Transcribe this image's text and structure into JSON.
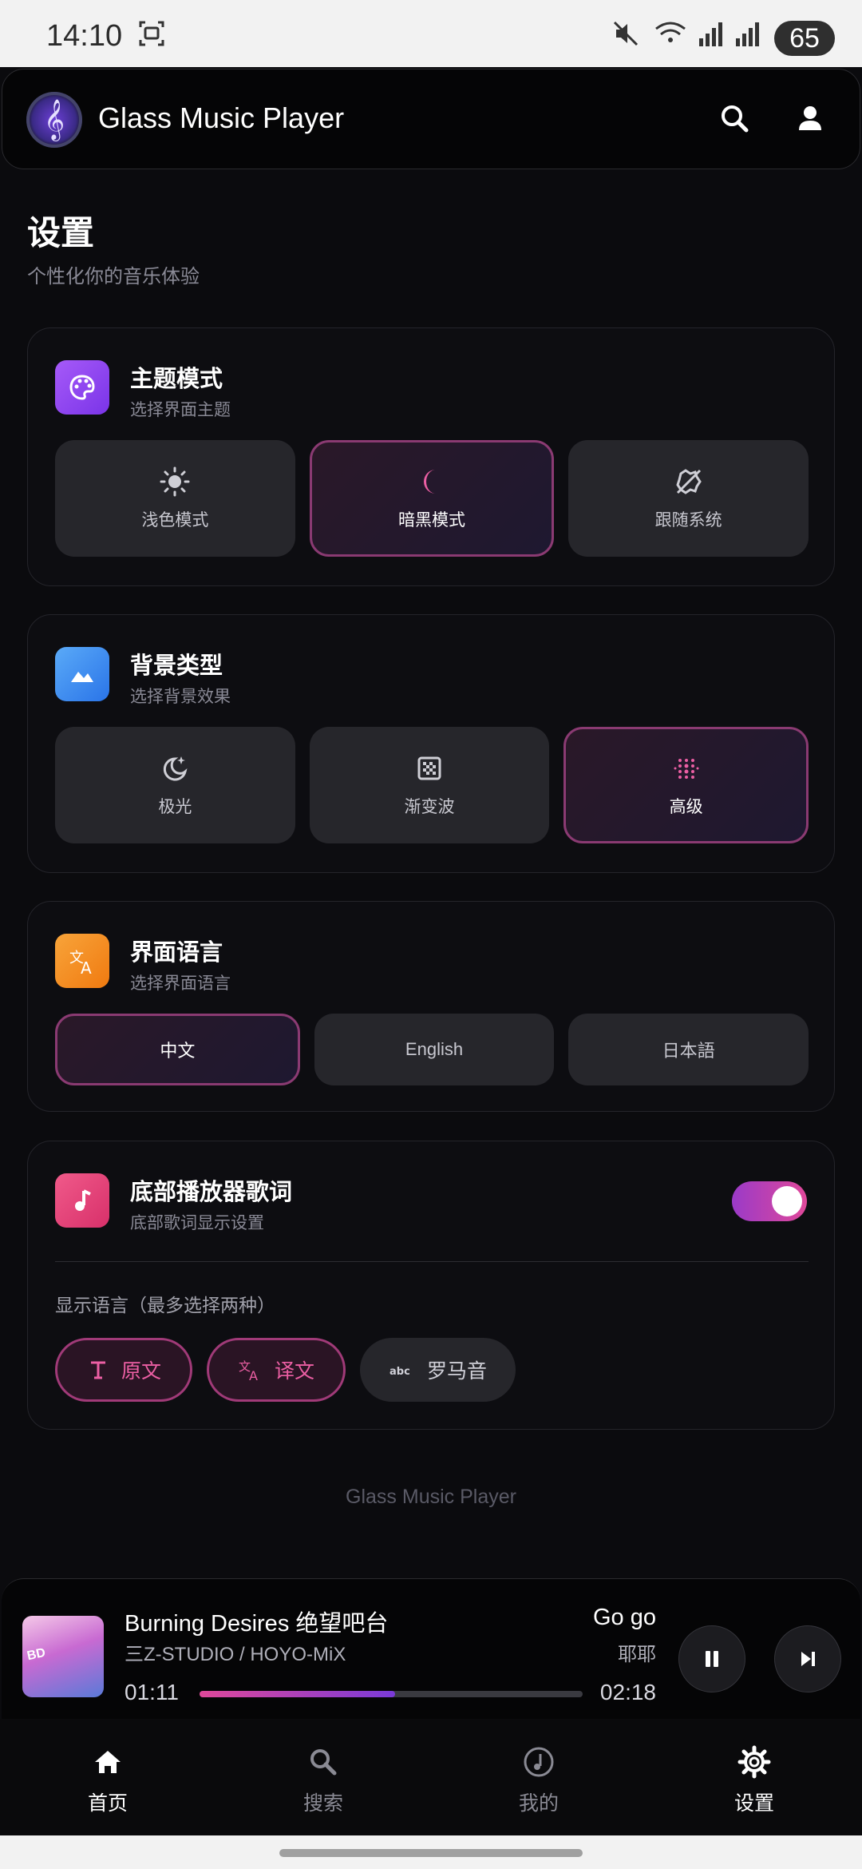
{
  "status_bar": {
    "time": "14:10",
    "battery": "65"
  },
  "app": {
    "title": "Glass Music Player",
    "logo_glyph": "𝄞"
  },
  "page": {
    "title": "设置",
    "subtitle": "个性化你的音乐体验"
  },
  "theme": {
    "title": "主题模式",
    "subtitle": "选择界面主题",
    "accent": "#8b46f0",
    "options": [
      {
        "label": "浅色模式",
        "icon": "sun-icon",
        "selected": false
      },
      {
        "label": "暗黑模式",
        "icon": "moon-icon",
        "selected": true
      },
      {
        "label": "跟随系统",
        "icon": "auto-brightness-icon",
        "selected": false
      }
    ]
  },
  "background": {
    "title": "背景类型",
    "subtitle": "选择背景效果",
    "accent": "#3d8ff0",
    "options": [
      {
        "label": "极光",
        "icon": "night-icon",
        "selected": false
      },
      {
        "label": "渐变波",
        "icon": "gradient-icon",
        "selected": false
      },
      {
        "label": "高级",
        "icon": "grain-icon",
        "selected": true
      }
    ]
  },
  "language": {
    "title": "界面语言",
    "subtitle": "选择界面语言",
    "accent": "#f28a1a",
    "options": [
      {
        "label": "中文",
        "selected": true
      },
      {
        "label": "English",
        "selected": false
      },
      {
        "label": "日本語",
        "selected": false
      }
    ]
  },
  "lyrics": {
    "title": "底部播放器歌词",
    "subtitle": "底部歌词显示设置",
    "accent": "#e8407a",
    "enabled": true,
    "display_label": "显示语言（最多选择两种）",
    "chips": [
      {
        "label": "原文",
        "icon": "text-icon",
        "selected": true
      },
      {
        "label": "译文",
        "icon": "translate-icon",
        "selected": true
      },
      {
        "label": "罗马音",
        "icon": "abc-icon",
        "selected": false
      }
    ]
  },
  "footer": {
    "app_name": "Glass Music Player"
  },
  "player": {
    "title": "Burning Desires 绝望吧台",
    "artist": "三Z-STUDIO / HOYO-MiX",
    "lyric_line": "Go go",
    "lyric_translation": "耶耶",
    "current_time": "01:11",
    "total_time": "02:18",
    "progress": 0.51,
    "cover_text": "BD"
  },
  "nav": [
    {
      "label": "首页",
      "icon": "home-icon",
      "active": true
    },
    {
      "label": "搜索",
      "icon": "search-icon",
      "active": false
    },
    {
      "label": "我的",
      "icon": "music-note-icon",
      "active": false
    },
    {
      "label": "设置",
      "icon": "settings-icon",
      "active": true
    }
  ],
  "colors": {
    "selected_border": "#8a3a72",
    "pink": "#ec5fa4"
  }
}
